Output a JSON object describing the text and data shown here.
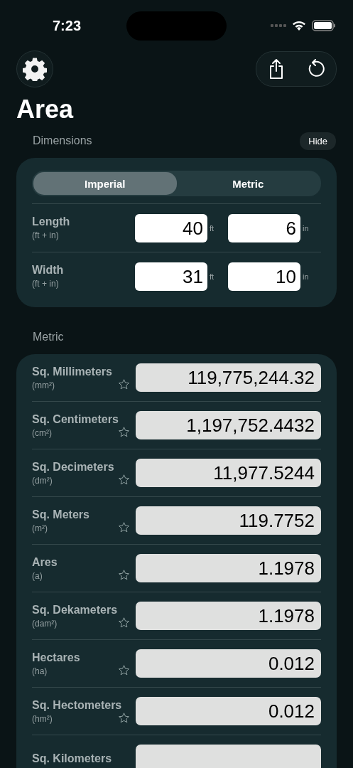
{
  "status_bar": {
    "time": "7:23"
  },
  "title": "Area",
  "dimensions": {
    "heading": "Dimensions",
    "hide_button": "Hide",
    "segments": [
      {
        "label": "Imperial",
        "selected": true
      },
      {
        "label": "Metric",
        "selected": false
      }
    ],
    "rows": [
      {
        "name": "Length",
        "units": "(ft + in)",
        "fields": [
          {
            "value": "40",
            "unit": "ft"
          },
          {
            "value": "6",
            "unit": "in"
          }
        ]
      },
      {
        "name": "Width",
        "units": "(ft + in)",
        "fields": [
          {
            "value": "31",
            "unit": "ft"
          },
          {
            "value": "10",
            "unit": "in"
          }
        ]
      }
    ]
  },
  "metric": {
    "heading": "Metric",
    "rows": [
      {
        "name": "Sq. Millimeters",
        "symbol": "(mm²)",
        "value": "119,775,244.32",
        "favorite": false
      },
      {
        "name": "Sq. Centimeters",
        "symbol": "(cm²)",
        "value": "1,197,752.4432",
        "favorite": false
      },
      {
        "name": "Sq. Decimeters",
        "symbol": "(dm²)",
        "value": "11,977.5244",
        "favorite": false
      },
      {
        "name": "Sq. Meters",
        "symbol": "(m²)",
        "value": "119.7752",
        "favorite": false
      },
      {
        "name": "Ares",
        "symbol": "(a)",
        "value": "1.1978",
        "favorite": false
      },
      {
        "name": "Sq. Dekameters",
        "symbol": "(dam²)",
        "value": "1.1978",
        "favorite": false
      },
      {
        "name": "Hectares",
        "symbol": "(ha)",
        "value": "0.012",
        "favorite": false
      },
      {
        "name": "Sq. Hectometers",
        "symbol": "(hm²)",
        "value": "0.012",
        "favorite": false
      },
      {
        "name": "Sq. Kilometers"
      }
    ]
  }
}
